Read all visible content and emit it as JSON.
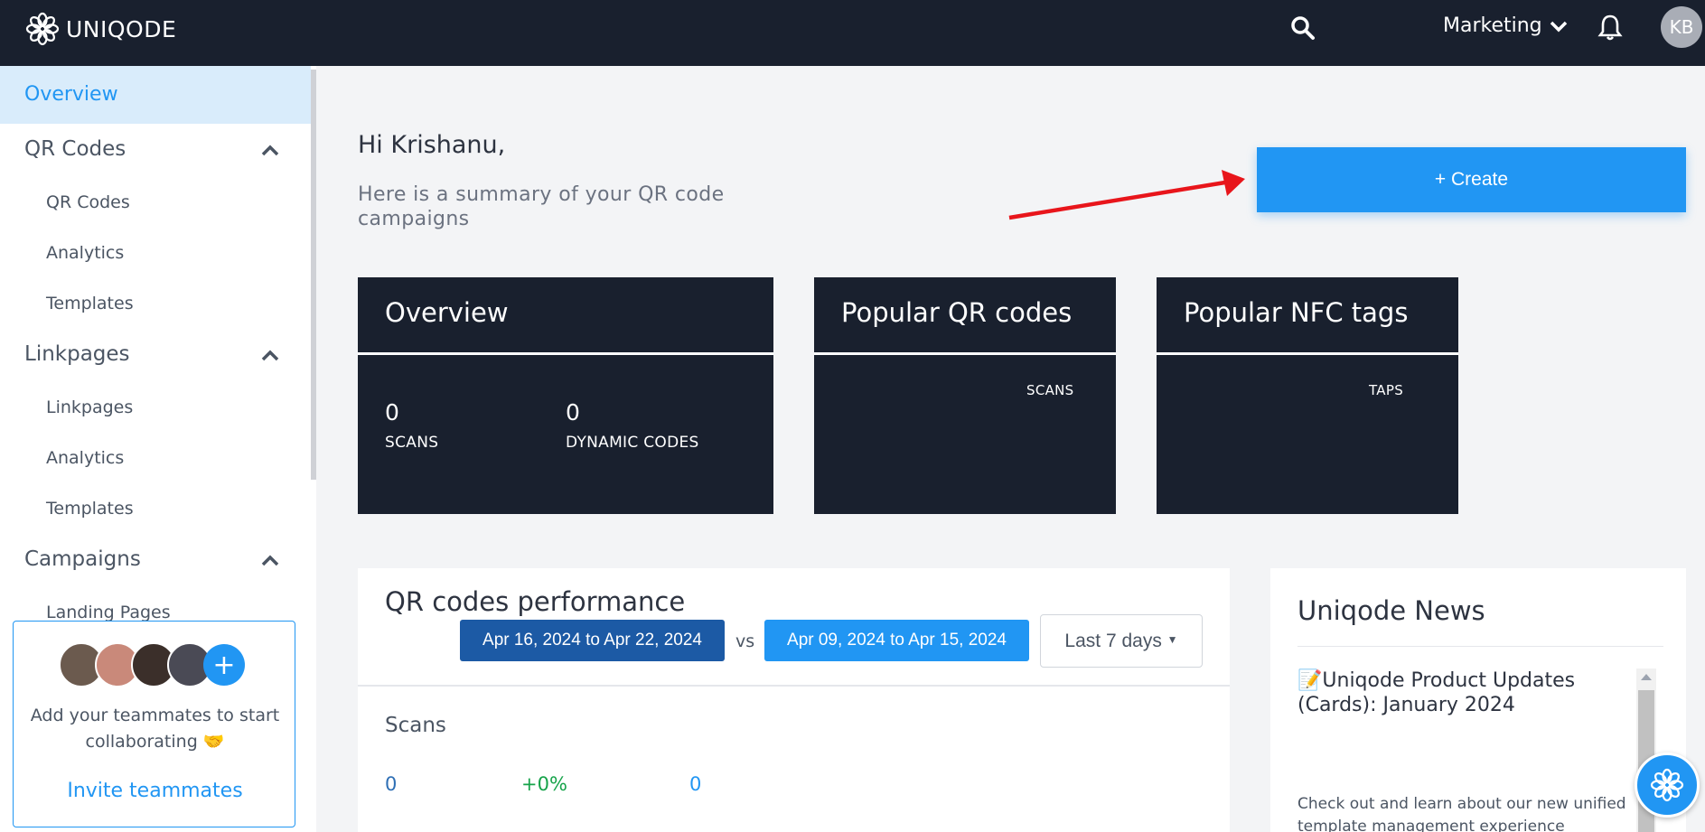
{
  "topbar": {
    "brand": "UNIQODE",
    "workspace": "Marketing",
    "user_initials": "KB"
  },
  "sidebar": {
    "active": "Overview",
    "groups": [
      {
        "label": "QR Codes",
        "items": [
          "QR Codes",
          "Analytics",
          "Templates"
        ]
      },
      {
        "label": "Linkpages",
        "items": [
          "Linkpages",
          "Analytics",
          "Templates"
        ]
      },
      {
        "label": "Campaigns",
        "items": [
          "Landing Pages"
        ]
      }
    ],
    "invite": {
      "text": "Add your teammates to start collaborating 🤝",
      "link": "Invite teammates"
    }
  },
  "main": {
    "greeting": "Hi Krishanu,",
    "subtitle": "Here is a summary of your QR code campaigns",
    "create_label": "+ Create",
    "overview": {
      "title": "Overview",
      "stats": [
        {
          "value": "0",
          "label": "SCANS"
        },
        {
          "value": "0",
          "label": "DYNAMIC CODES"
        }
      ]
    },
    "popular_qr": {
      "title": "Popular QR codes",
      "column": "SCANS"
    },
    "popular_nfc": {
      "title": "Popular NFC tags",
      "column": "TAPS"
    },
    "performance": {
      "title": "QR codes performance",
      "current_range": "Apr 16, 2024 to Apr 22, 2024",
      "vs": "vs",
      "previous_range": "Apr 09, 2024 to Apr 15, 2024",
      "period": "Last 7 days",
      "metric_label": "Scans",
      "current_value": "0",
      "change": "+0%",
      "previous_value": "0"
    },
    "news": {
      "title": "Uniqode News",
      "headline": "📝Uniqode Product Updates (Cards): January 2024",
      "body": "Check out and learn about our new unified template management experience"
    }
  },
  "colors": {
    "navy": "#19202e",
    "primary": "#2196f3",
    "date_dark": "#1c5aa5",
    "positive": "#16a34a"
  },
  "icons": [
    "uniqode-logo-icon",
    "search-icon",
    "chevron-down-icon",
    "bell-icon",
    "chevron-up-icon",
    "plus-icon",
    "annotation-arrow",
    "chat-support-icon"
  ]
}
